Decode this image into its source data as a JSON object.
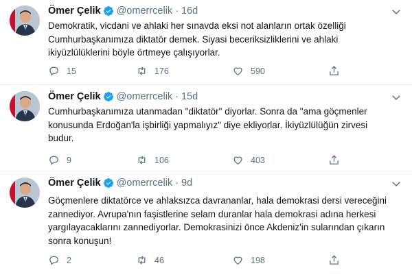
{
  "tweets": [
    {
      "name": "Ömer Çelik",
      "handle": "@omerrcelik",
      "time": "16d",
      "text": "Demokratik, vicdani ve ahlaki her sınavda eksi not alanların ortak özelliği Cumhurbaşkanımıza diktatör demek. Siyasi beceriksizliklerini ve ahlaki ikiyüzlülüklerini böyle örtmeye çalışıyorlar.",
      "replies": "15",
      "retweets": "176",
      "likes": "590"
    },
    {
      "name": "Ömer Çelik",
      "handle": "@omerrcelik",
      "time": "15d",
      "text": "Cumhurbaşkanımıza utanmadan \"diktatör\" diyorlar. Sonra da \"ama göçmenler konusunda Erdoğan'la işbirliği yapmalıyız\" diye ekliyorlar. İkiyüzlülüğün zirvesi budur.",
      "replies": "9",
      "retweets": "106",
      "likes": "403"
    },
    {
      "name": "Ömer Çelik",
      "handle": "@omerrcelik",
      "time": "9d",
      "text": "Göçmenlere diktatörce ve ahlaksızca davrananlar, hala demokrasi dersi vereceğini zannediyor. Avrupa'nın faşistlerine selam duranlar hala demokrasi adına herkesi yargılayacaklarını zannediyorlar. Demokrasinizi önce Akdeniz'in sularından çıkarın sonra konuşun!",
      "replies": "2",
      "retweets": "46",
      "likes": "198"
    }
  ],
  "colors": {
    "verified": "#1da1f2",
    "muted": "#5b7083",
    "text": "#0f1419",
    "divider": "#e6ecf0"
  },
  "icons": [
    "verified-badge-icon",
    "chevron-down-icon",
    "reply-icon",
    "retweet-icon",
    "like-icon",
    "share-icon"
  ]
}
